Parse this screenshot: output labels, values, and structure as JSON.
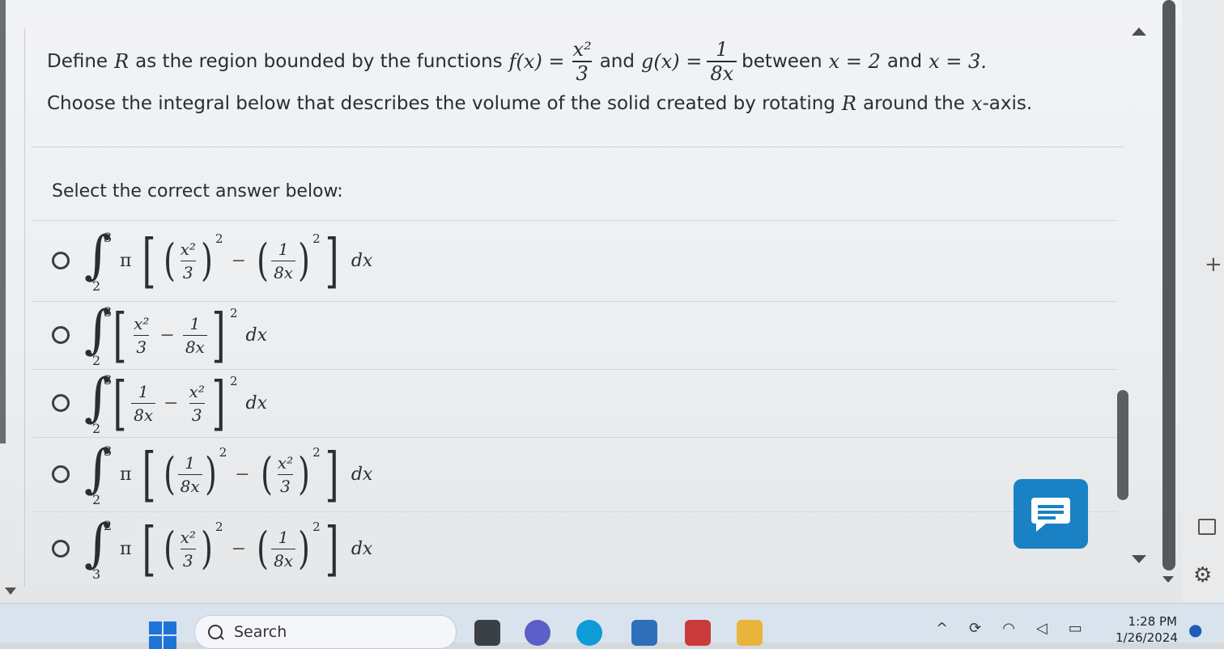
{
  "question": {
    "define_word": "Define",
    "region_var": "R",
    "text_bounded": "as the region bounded by the functions",
    "f_lhs": "f(x) =",
    "f_num": "x²",
    "f_den": "3",
    "and_word": "and",
    "g_lhs": "g(x) =",
    "g_num": "1",
    "g_den": "8x",
    "between_word": "between",
    "lower_bound": "x = 2",
    "and_word2": "and",
    "upper_bound": "x = 3.",
    "line2_before": "Choose the integral below that describes the volume of the solid created by rotating",
    "line2_region": "R",
    "line2_after": "around the",
    "axis_var": "x",
    "axis_suffix": "-axis."
  },
  "answers": {
    "select_label": "Select the correct answer below:",
    "options": [
      {
        "upper": "3",
        "lower": "2",
        "pi": "π",
        "a_num": "x²",
        "a_den": "3",
        "b_num": "1",
        "b_den": "8x",
        "exp": "2",
        "op": "−",
        "dx": "dx"
      },
      {
        "upper": "3",
        "lower": "2",
        "a_num": "x²",
        "a_den": "3",
        "b_num": "1",
        "b_den": "8x",
        "exp": "2",
        "op": "−",
        "dx": "dx"
      },
      {
        "upper": "3",
        "lower": "2",
        "a_num": "1",
        "a_den": "8x",
        "b_num": "x²",
        "b_den": "3",
        "exp": "2",
        "op": "−",
        "dx": "dx"
      },
      {
        "upper": "3",
        "lower": "2",
        "pi": "π",
        "a_num": "1",
        "a_den": "8x",
        "b_num": "x²",
        "b_den": "3",
        "exp": "2",
        "op": "−",
        "dx": "dx"
      },
      {
        "upper": "2",
        "lower": "3",
        "pi": "π",
        "a_num": "x²",
        "a_den": "3",
        "b_num": "1",
        "b_den": "8x",
        "exp": "2",
        "op": "−",
        "dx": "dx"
      }
    ]
  },
  "taskbar": {
    "search_label": "Search",
    "time": "1:28 PM",
    "date": "1/26/2024"
  },
  "colors": {
    "chat_button": "#1a82c4",
    "windows_logo": "#1e74d6"
  }
}
